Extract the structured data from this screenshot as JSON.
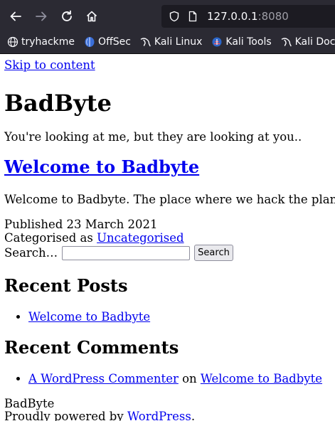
{
  "browser": {
    "url_host": "127.0.0.1",
    "url_port": ":8080",
    "bookmarks": [
      {
        "label": "tryhackme",
        "icon": "globe-icon"
      },
      {
        "label": "OffSec",
        "icon": "offsec-icon"
      },
      {
        "label": "Kali Linux",
        "icon": "kali-dragon-icon"
      },
      {
        "label": "Kali Tools",
        "icon": "kali-tools-icon"
      },
      {
        "label": "Kali Docs",
        "icon": "kali-dragon-icon"
      }
    ]
  },
  "page": {
    "skip_link": "Skip to content",
    "site_title": "BadByte",
    "tagline": "You're looking at me, but they are looking at you..",
    "post_title": "Welcome to Badbyte",
    "excerpt": "Welcome to Badbyte. The place where we hack the planet",
    "published": "Published 23 March 2021",
    "categorised_prefix": "Categorised as ",
    "category": "Uncategorised",
    "search_label": "Search…",
    "search_value": "",
    "search_button": "Search",
    "recent_posts_title": "Recent Posts",
    "recent_posts": [
      "Welcome to Badbyte"
    ],
    "recent_comments_title": "Recent Comments",
    "recent_comments": [
      {
        "author": "A WordPress Commenter",
        "connector": " on ",
        "post": "Welcome to Badbyte"
      }
    ],
    "footer_site": "BadByte",
    "powered_prefix": "Proudly powered by ",
    "powered_link": "WordPress",
    "powered_suffix": "."
  }
}
